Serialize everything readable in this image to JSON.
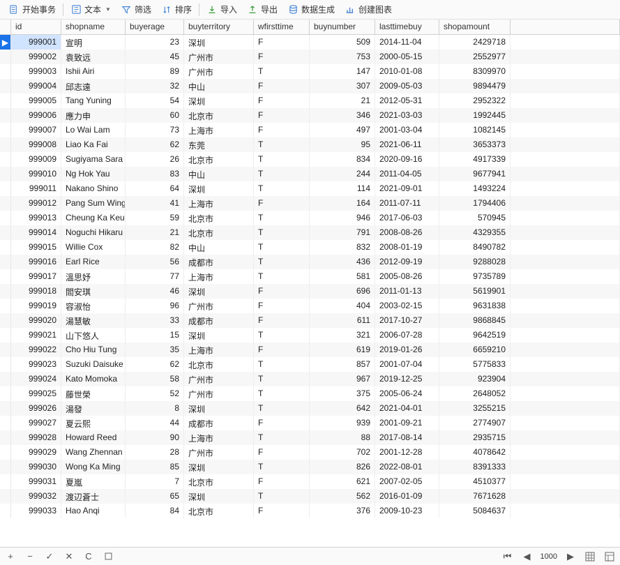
{
  "toolbar": {
    "begin_transaction": "开始事务",
    "text": "文本",
    "filter": "筛选",
    "sort": "排序",
    "import": "导入",
    "export": "导出",
    "data_gen": "数据生成",
    "create_chart": "创建图表"
  },
  "columns": [
    "id",
    "shopname",
    "buyerage",
    "buyterritory",
    "wfirsttime",
    "buynumber",
    "lasttimebuy",
    "shopamount"
  ],
  "rows": [
    {
      "id": "999001",
      "shopname": "宣明",
      "buyerage": "23",
      "buyterritory": "深圳",
      "wfirsttime": "F",
      "buynumber": "509",
      "lasttimebuy": "2014-11-04",
      "shopamount": "2429718"
    },
    {
      "id": "999002",
      "shopname": "袁致远",
      "buyerage": "45",
      "buyterritory": "广州市",
      "wfirsttime": "F",
      "buynumber": "753",
      "lasttimebuy": "2000-05-15",
      "shopamount": "2552977"
    },
    {
      "id": "999003",
      "shopname": "Ishii Airi",
      "buyerage": "89",
      "buyterritory": "广州市",
      "wfirsttime": "T",
      "buynumber": "147",
      "lasttimebuy": "2010-01-08",
      "shopamount": "8309970"
    },
    {
      "id": "999004",
      "shopname": "邱志遠",
      "buyerage": "32",
      "buyterritory": "中山",
      "wfirsttime": "F",
      "buynumber": "307",
      "lasttimebuy": "2009-05-03",
      "shopamount": "9894479"
    },
    {
      "id": "999005",
      "shopname": "Tang Yuning",
      "buyerage": "54",
      "buyterritory": "深圳",
      "wfirsttime": "F",
      "buynumber": "21",
      "lasttimebuy": "2012-05-31",
      "shopamount": "2952322"
    },
    {
      "id": "999006",
      "shopname": "應力申",
      "buyerage": "60",
      "buyterritory": "北京市",
      "wfirsttime": "F",
      "buynumber": "346",
      "lasttimebuy": "2021-03-03",
      "shopamount": "1992445"
    },
    {
      "id": "999007",
      "shopname": "Lo Wai Lam",
      "buyerage": "73",
      "buyterritory": "上海市",
      "wfirsttime": "F",
      "buynumber": "497",
      "lasttimebuy": "2001-03-04",
      "shopamount": "1082145"
    },
    {
      "id": "999008",
      "shopname": "Liao Ka Fai",
      "buyerage": "62",
      "buyterritory": "东莞",
      "wfirsttime": "T",
      "buynumber": "95",
      "lasttimebuy": "2021-06-11",
      "shopamount": "3653373"
    },
    {
      "id": "999009",
      "shopname": "Sugiyama Sara",
      "buyerage": "26",
      "buyterritory": "北京市",
      "wfirsttime": "T",
      "buynumber": "834",
      "lasttimebuy": "2020-09-16",
      "shopamount": "4917339"
    },
    {
      "id": "999010",
      "shopname": "Ng Hok Yau",
      "buyerage": "83",
      "buyterritory": "中山",
      "wfirsttime": "T",
      "buynumber": "244",
      "lasttimebuy": "2011-04-05",
      "shopamount": "9677941"
    },
    {
      "id": "999011",
      "shopname": "Nakano Shino",
      "buyerage": "64",
      "buyterritory": "深圳",
      "wfirsttime": "T",
      "buynumber": "114",
      "lasttimebuy": "2021-09-01",
      "shopamount": "1493224"
    },
    {
      "id": "999012",
      "shopname": "Pang Sum Wing",
      "buyerage": "41",
      "buyterritory": "上海市",
      "wfirsttime": "F",
      "buynumber": "164",
      "lasttimebuy": "2011-07-11",
      "shopamount": "1794406"
    },
    {
      "id": "999013",
      "shopname": "Cheung Ka Keu",
      "buyerage": "59",
      "buyterritory": "北京市",
      "wfirsttime": "T",
      "buynumber": "946",
      "lasttimebuy": "2017-06-03",
      "shopamount": "570945"
    },
    {
      "id": "999014",
      "shopname": "Noguchi Hikaru",
      "buyerage": "21",
      "buyterritory": "北京市",
      "wfirsttime": "T",
      "buynumber": "791",
      "lasttimebuy": "2008-08-26",
      "shopamount": "4329355"
    },
    {
      "id": "999015",
      "shopname": "Willie Cox",
      "buyerage": "82",
      "buyterritory": "中山",
      "wfirsttime": "T",
      "buynumber": "832",
      "lasttimebuy": "2008-01-19",
      "shopamount": "8490782"
    },
    {
      "id": "999016",
      "shopname": "Earl Rice",
      "buyerage": "56",
      "buyterritory": "成都市",
      "wfirsttime": "T",
      "buynumber": "436",
      "lasttimebuy": "2012-09-19",
      "shopamount": "9288028"
    },
    {
      "id": "999017",
      "shopname": "溫思妤",
      "buyerage": "77",
      "buyterritory": "上海市",
      "wfirsttime": "T",
      "buynumber": "581",
      "lasttimebuy": "2005-08-26",
      "shopamount": "9735789"
    },
    {
      "id": "999018",
      "shopname": "閻安琪",
      "buyerage": "46",
      "buyterritory": "深圳",
      "wfirsttime": "F",
      "buynumber": "696",
      "lasttimebuy": "2011-01-13",
      "shopamount": "5619901"
    },
    {
      "id": "999019",
      "shopname": "容淑怡",
      "buyerage": "96",
      "buyterritory": "广州市",
      "wfirsttime": "F",
      "buynumber": "404",
      "lasttimebuy": "2003-02-15",
      "shopamount": "9631838"
    },
    {
      "id": "999020",
      "shopname": "湯慧敏",
      "buyerage": "33",
      "buyterritory": "成都市",
      "wfirsttime": "F",
      "buynumber": "611",
      "lasttimebuy": "2017-10-27",
      "shopamount": "9868845"
    },
    {
      "id": "999021",
      "shopname": "山下悠人",
      "buyerage": "15",
      "buyterritory": "深圳",
      "wfirsttime": "T",
      "buynumber": "321",
      "lasttimebuy": "2006-07-28",
      "shopamount": "9642519"
    },
    {
      "id": "999022",
      "shopname": "Cho Hiu Tung",
      "buyerage": "35",
      "buyterritory": "上海市",
      "wfirsttime": "F",
      "buynumber": "619",
      "lasttimebuy": "2019-01-26",
      "shopamount": "6659210"
    },
    {
      "id": "999023",
      "shopname": "Suzuki Daisuke",
      "buyerage": "62",
      "buyterritory": "北京市",
      "wfirsttime": "T",
      "buynumber": "857",
      "lasttimebuy": "2001-07-04",
      "shopamount": "5775833"
    },
    {
      "id": "999024",
      "shopname": "Kato Momoka",
      "buyerage": "58",
      "buyterritory": "广州市",
      "wfirsttime": "T",
      "buynumber": "967",
      "lasttimebuy": "2019-12-25",
      "shopamount": "923904"
    },
    {
      "id": "999025",
      "shopname": "藤世榮",
      "buyerage": "52",
      "buyterritory": "广州市",
      "wfirsttime": "T",
      "buynumber": "375",
      "lasttimebuy": "2005-06-24",
      "shopamount": "2648052"
    },
    {
      "id": "999026",
      "shopname": "湯發",
      "buyerage": "8",
      "buyterritory": "深圳",
      "wfirsttime": "T",
      "buynumber": "642",
      "lasttimebuy": "2021-04-01",
      "shopamount": "3255215"
    },
    {
      "id": "999027",
      "shopname": "夏云熙",
      "buyerage": "44",
      "buyterritory": "成都市",
      "wfirsttime": "F",
      "buynumber": "939",
      "lasttimebuy": "2001-09-21",
      "shopamount": "2774907"
    },
    {
      "id": "999028",
      "shopname": "Howard Reed",
      "buyerage": "90",
      "buyterritory": "上海市",
      "wfirsttime": "T",
      "buynumber": "88",
      "lasttimebuy": "2017-08-14",
      "shopamount": "2935715"
    },
    {
      "id": "999029",
      "shopname": "Wang Zhennan",
      "buyerage": "28",
      "buyterritory": "广州市",
      "wfirsttime": "F",
      "buynumber": "702",
      "lasttimebuy": "2001-12-28",
      "shopamount": "4078642"
    },
    {
      "id": "999030",
      "shopname": "Wong Ka Ming",
      "buyerage": "85",
      "buyterritory": "深圳",
      "wfirsttime": "T",
      "buynumber": "826",
      "lasttimebuy": "2022-08-01",
      "shopamount": "8391333"
    },
    {
      "id": "999031",
      "shopname": "夏嵐",
      "buyerage": "7",
      "buyterritory": "北京市",
      "wfirsttime": "F",
      "buynumber": "621",
      "lasttimebuy": "2007-02-05",
      "shopamount": "4510377"
    },
    {
      "id": "999032",
      "shopname": "渡辺蒼士",
      "buyerage": "65",
      "buyterritory": "深圳",
      "wfirsttime": "T",
      "buynumber": "562",
      "lasttimebuy": "2016-01-09",
      "shopamount": "7671628"
    },
    {
      "id": "999033",
      "shopname": "Hao Anqi",
      "buyerage": "84",
      "buyterritory": "北京市",
      "wfirsttime": "F",
      "buynumber": "376",
      "lasttimebuy": "2009-10-23",
      "shopamount": "5084637"
    }
  ],
  "status": {
    "row_count_label": "1000"
  }
}
